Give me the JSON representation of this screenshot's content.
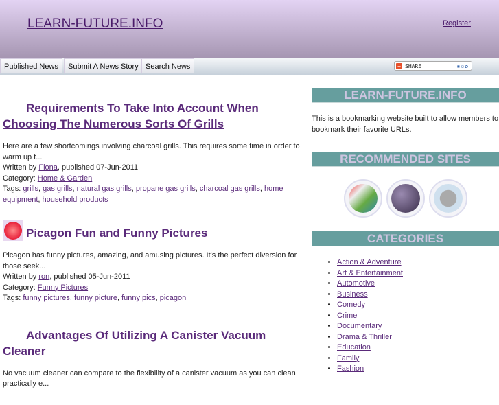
{
  "header": {
    "logo": "LEARN-FUTURE.INFO",
    "register": "Register"
  },
  "nav": [
    "Published News",
    "Submit A News Story",
    "Search News"
  ],
  "share": {
    "label": "SHARE"
  },
  "articles": [
    {
      "title": "Requirements To Take Into Account When Choosing The Numerous Sorts Of Grills",
      "excerpt": "Here are a few shortcomings involving charcoal grills. This requires some time in order to warm up t...",
      "written_by": "Written by ",
      "author": "Fiona",
      "published": ", published 07-Jun-2011",
      "category_label": "Category: ",
      "category": "Home & Garden",
      "tags_label": "Tags: ",
      "tags": [
        "grills",
        "gas grills",
        "natural gas grills",
        "propane gas grills",
        "charcoal gas grills",
        "home equipment",
        "household products"
      ]
    },
    {
      "title": "Picagon Fun and Funny Pictures",
      "excerpt": "Picagon has funny pictures, amazing, and amusing pictures. It's the perfect diversion for those seek...",
      "written_by": "Written by ",
      "author": "ron",
      "published": ", published 05-Jun-2011",
      "category_label": "Category: ",
      "category": "Funny Pictures",
      "tags_label": "Tags: ",
      "tags": [
        "funny pictures",
        "funny picture",
        "funny pics",
        "picagon"
      ]
    },
    {
      "title": "Advantages Of Utilizing A Canister Vacuum Cleaner",
      "excerpt": "No vacuum cleaner can compare to the flexibility of a canister vacuum as you can clean practically e..."
    }
  ],
  "sidebar": {
    "about_heading": "LEARN-FUTURE.INFO",
    "about_text": "This is a bookmarking website built to allow members to bookmark their favorite URLs.",
    "recommended_heading": "RECOMMENDED SITES",
    "categories_heading": "CATEGORIES",
    "categories": [
      "Action & Adventure",
      "Art & Entertainment",
      "Automotive",
      "Business",
      "Comedy",
      "Crime",
      "Documentary",
      "Drama & Thriller",
      "Education",
      "Family",
      "Fashion"
    ]
  }
}
